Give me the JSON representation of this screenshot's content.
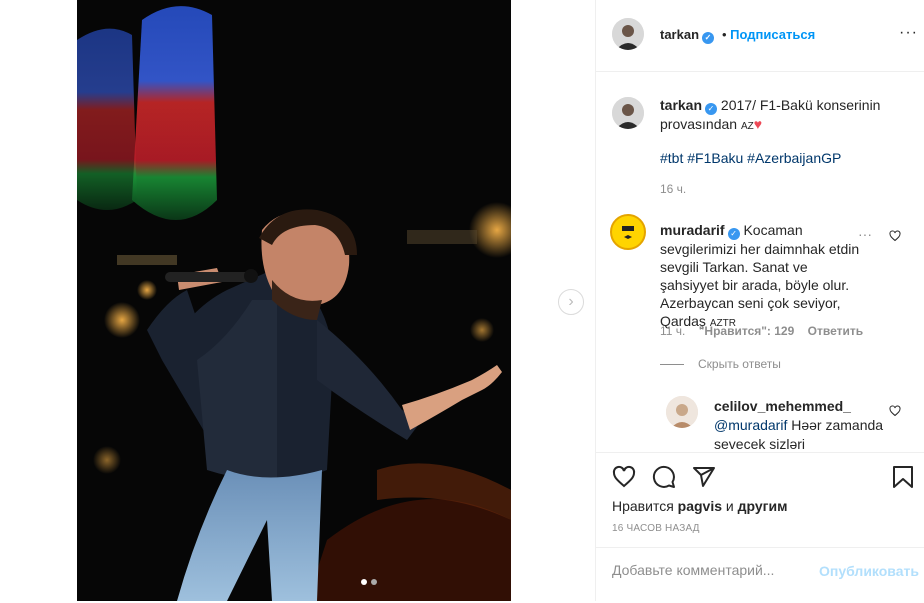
{
  "header": {
    "username": "tarkan",
    "follow_label": "Подписаться",
    "more_label": "···"
  },
  "caption": {
    "username": "tarkan",
    "text": "2017/ F1-Bakü konserinin provasından",
    "flag": "AZ",
    "hashtags": "#tbt #F1Baku #AzerbaijanGP",
    "time": "16 ч."
  },
  "comment1": {
    "username": "muradarif",
    "text": "Kocaman sevgilerimizi her daimnhak etdin sevgili Tarkan. Sanat ve şahsiyyet bir arada, böyle olur. Azerbaycan seni çok seviyor, Qardaş",
    "flags": "AZTR",
    "time": "11 ч.",
    "likes": "\"Нравится\": 129",
    "reply_label": "Ответить",
    "more": "···",
    "hide_replies": "Скрыть ответы"
  },
  "reply1": {
    "username": "celilov_mehemmed_",
    "mention": "@muradarif",
    "text": "Həər zamanda sevecek sizləri"
  },
  "actions": {
    "likes_prefix": "Нравится",
    "likes_user": "pagvis",
    "likes_and": "и",
    "likes_others": "другим",
    "post_time": "16 ЧАСОВ НАЗАД"
  },
  "comment_box": {
    "placeholder": "Добавьте комментарий...",
    "publish_label": "Опубликовать"
  },
  "colors": {
    "accent": "#0095f6",
    "verified": "#3897f0",
    "heart": "#ed4956"
  },
  "icons": [
    "heart-icon",
    "comment-icon",
    "share-icon",
    "bookmark-icon",
    "verified-icon",
    "chevron-right-icon"
  ]
}
